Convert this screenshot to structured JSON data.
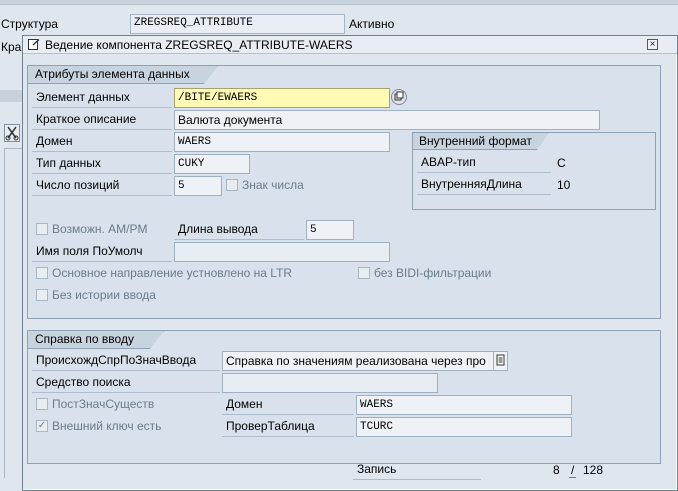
{
  "background": {
    "structure_label": "Структура",
    "structure_value": "ZREGSREQ_ATTRIBUTE",
    "status": "Активно",
    "short_label_fragment": "Кра"
  },
  "dialog": {
    "title": "Ведение компонента ZREGSREQ_ATTRIBUTE-WAERS",
    "close_glyph": "×"
  },
  "attributes_group": {
    "title": "Атрибуты элемента данных",
    "data_element_label": "Элемент данных",
    "data_element_value": "/BITE/EWAERS",
    "short_desc_label": "Краткое описание",
    "short_desc_value": "Валюта документа",
    "domain_label": "Домен",
    "domain_value": "WAERS",
    "data_type_label": "Тип данных",
    "data_type_value": "CUKY",
    "positions_label": "Число позиций",
    "positions_value": "5",
    "sign_label": "Знак числа",
    "lowercase_label": "Возможн. AM/PM",
    "output_length_label": "Длина вывода",
    "output_length_value": "5",
    "default_field_label": "Имя поля ПоУмолч",
    "default_field_value": "",
    "ltr_label": "Основное направление устновлено на LTR",
    "bidi_label": "без BIDI-фильтрации",
    "history_label": "Без истории ввода",
    "internal_format": {
      "title": "Внутренний формат",
      "abap_type_label": "ABAP-тип",
      "abap_type_value": "C",
      "internal_length_label": "ВнутренняяДлина",
      "internal_length_value": "10"
    }
  },
  "input_help_group": {
    "title": "Справка по вводу",
    "origin_label": "ПроисхождСпрПоЗначВвода",
    "origin_value": "Справка по значениям реализована через про",
    "search_help_label": "Средство поиска",
    "search_help_value": "",
    "fixed_values_label": "ПостЗначСуществ",
    "domain_label": "Домен",
    "domain_value": "WAERS",
    "foreign_key_label": "Внешний ключ есть",
    "check_table_label": "ПроверТаблица",
    "check_table_value": "TCURC",
    "foreign_key_checked": true
  },
  "footer": {
    "record_label": "Запись",
    "current": "8",
    "separator": "/",
    "total": "128"
  },
  "colors": {
    "dialog_bg": "#dfe6ee",
    "active_field": "#fffbb5",
    "group_tab": "#c7d3df"
  }
}
